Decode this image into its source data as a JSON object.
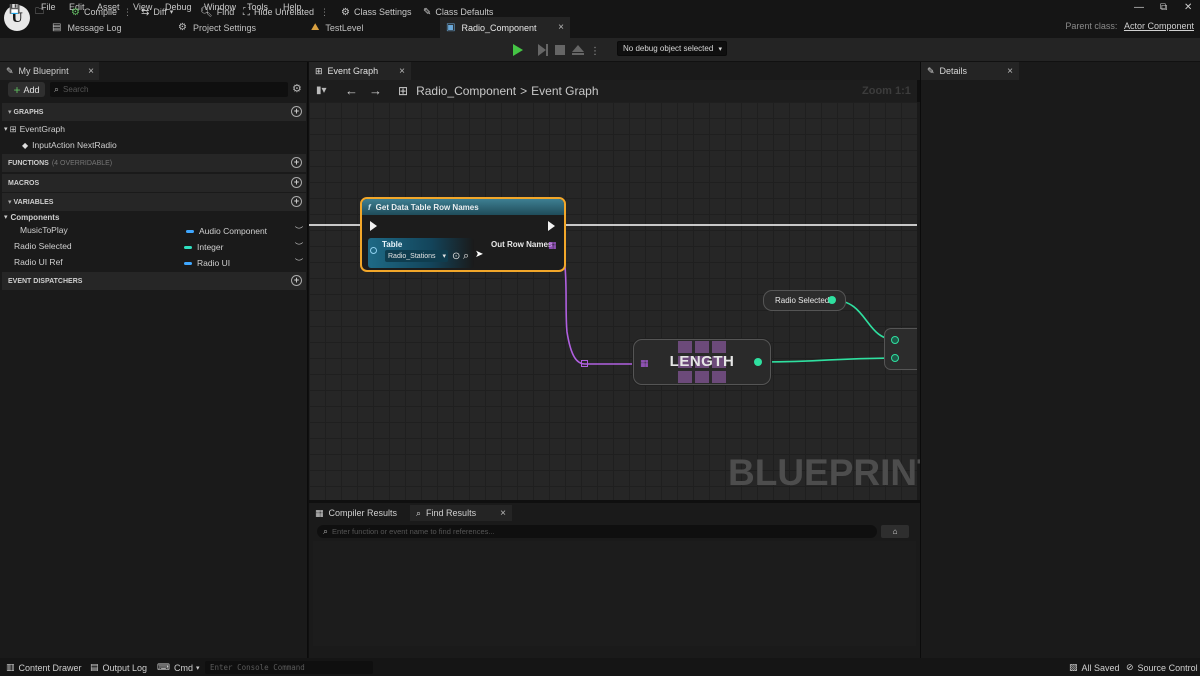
{
  "menu": [
    "File",
    "Edit",
    "Asset",
    "View",
    "Debug",
    "Window",
    "Tools",
    "Help"
  ],
  "tabs": [
    {
      "label": "Message Log",
      "icon": "message-log-icon"
    },
    {
      "label": "Project Settings",
      "icon": "settings-icon"
    },
    {
      "label": "TestLevel",
      "icon": "level-icon"
    },
    {
      "label": "Radio_Component",
      "icon": "blueprint-icon",
      "close": "×"
    }
  ],
  "parent_class": {
    "label": "Parent class:",
    "value": "Actor Component"
  },
  "toolbar": {
    "compile": "Compile",
    "diff": "Diff",
    "find": "Find",
    "hide_unrelated": "Hide Unrelated",
    "class_settings": "Class Settings",
    "class_defaults": "Class Defaults",
    "debug_object": "No debug object selected"
  },
  "my_blueprint": {
    "tab": "My Blueprint",
    "close": "×",
    "add": "Add",
    "search_placeholder": "Search",
    "sections": {
      "graphs": "GRAPHS",
      "functions": "FUNCTIONS",
      "functions_note": "(4 OVERRIDABLE)",
      "macros": "MACROS",
      "variables": "VARIABLES",
      "components": "Components",
      "event_dispatchers": "EVENT DISPATCHERS"
    },
    "graphs": [
      "EventGraph",
      "InputAction NextRadio"
    ],
    "variables": [
      {
        "name": "MusicToPlay",
        "type": "Audio Component",
        "color": "#3fa7ff"
      },
      {
        "name": "Radio Selected",
        "type": "Integer",
        "color": "#2fe0c0"
      },
      {
        "name": "Radio UI Ref",
        "type": "Radio UI",
        "color": "#3fa7ff"
      }
    ]
  },
  "graph": {
    "tab": "Event Graph",
    "close": "×",
    "breadcrumb_root": "Radio_Component",
    "breadcrumb_sep": ">",
    "breadcrumb_leaf": "Event Graph",
    "zoom": "Zoom 1:1",
    "watermark": "BLUEPRINT",
    "nodes": {
      "get_rows": {
        "title": "Get Data Table Row Names",
        "table_label": "Table",
        "table_value": "Radio_Stations",
        "out_label": "Out Row Names",
        "border_color": "#f2a72a",
        "header_color": "#3e7f92"
      },
      "length": {
        "label": "LENGTH"
      },
      "radio_selected": {
        "label": "Radio Selected",
        "pin_color": "#2fe0a0"
      }
    },
    "wire_colors": {
      "exec": "#ffffff",
      "array_name": "#b060e0",
      "integer": "#2fe0a0"
    }
  },
  "bottom": {
    "tabs": [
      "Compiler Results",
      "Find Results"
    ],
    "close": "×",
    "find_placeholder": "Enter function or event name to find references..."
  },
  "details": {
    "tab": "Details",
    "close": "×"
  },
  "statusbar": {
    "content_drawer": "Content Drawer",
    "output_log": "Output Log",
    "cmd": "Cmd",
    "console_placeholder": "Enter Console Command",
    "all_saved": "All Saved",
    "source_control": "Source Control"
  }
}
